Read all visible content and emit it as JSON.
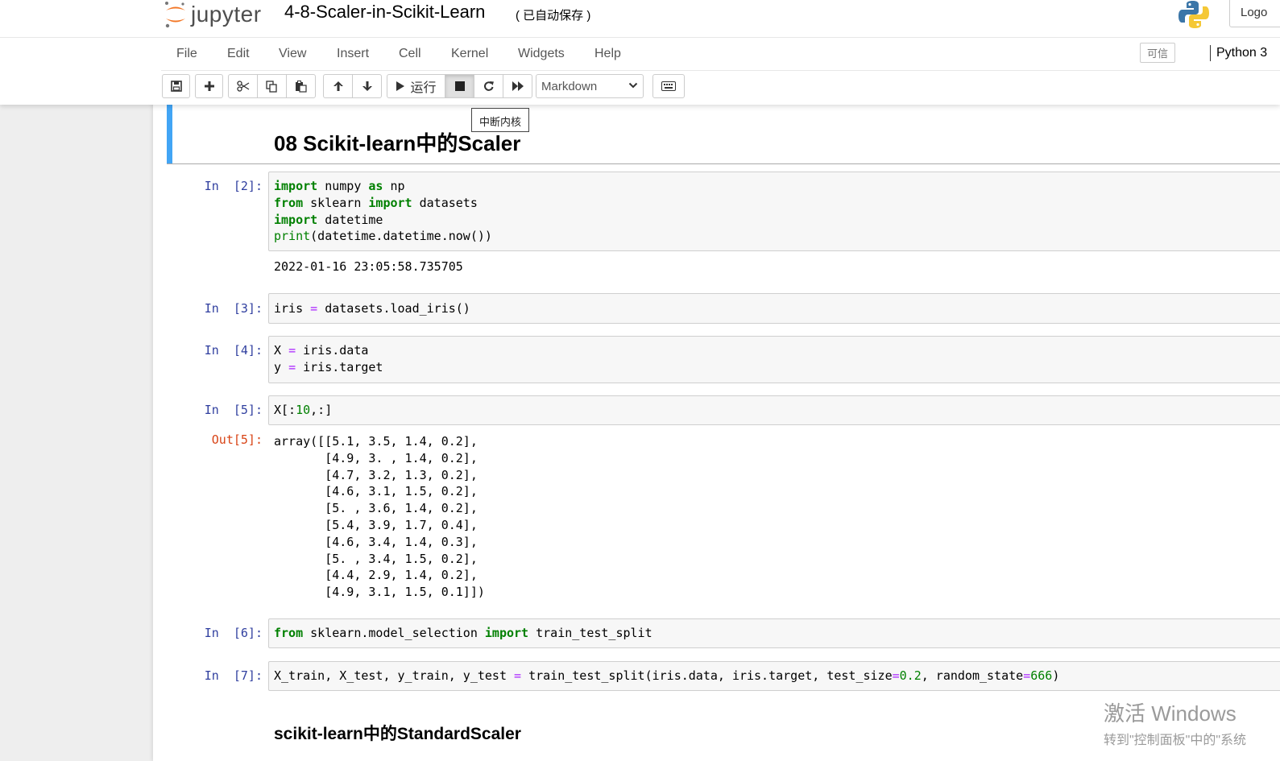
{
  "app": {
    "brand": "jupyter",
    "notebook_name": "4-8-Scaler-in-Scikit-Learn",
    "autosave_status": "( 已自动保存 )",
    "logout_label": "Logo",
    "trusted_label": "可信",
    "kernel_name": "Python 3"
  },
  "menu": [
    "File",
    "Edit",
    "View",
    "Insert",
    "Cell",
    "Kernel",
    "Widgets",
    "Help"
  ],
  "toolbar": {
    "run_label": "运行",
    "cell_type": "Markdown",
    "tooltip": "中断内核"
  },
  "cells": {
    "h2": "08 Scikit-learn中的Scaler",
    "c2": {
      "prompt": "In  [2]:",
      "output": "2022-01-16 23:05:58.735705"
    },
    "c3": {
      "prompt": "In  [3]:"
    },
    "c4": {
      "prompt": "In  [4]:"
    },
    "c5": {
      "prompt": "In  [5]:",
      "out_prompt": "Out[5]:",
      "output": "array([[5.1, 3.5, 1.4, 0.2],\n       [4.9, 3. , 1.4, 0.2],\n       [4.7, 3.2, 1.3, 0.2],\n       [4.6, 3.1, 1.5, 0.2],\n       [5. , 3.6, 1.4, 0.2],\n       [5.4, 3.9, 1.7, 0.4],\n       [4.6, 3.4, 1.4, 0.3],\n       [5. , 3.4, 1.5, 0.2],\n       [4.4, 2.9, 1.4, 0.2],\n       [4.9, 3.1, 1.5, 0.1]])"
    },
    "c6": {
      "prompt": "In  [6]:"
    },
    "c7": {
      "prompt": "In  [7]:"
    },
    "h3": "scikit-learn中的StandardScaler"
  },
  "watermark": {
    "line1": "激活 Windows",
    "line2": "转到\"控制面板\"中的\"系统"
  }
}
